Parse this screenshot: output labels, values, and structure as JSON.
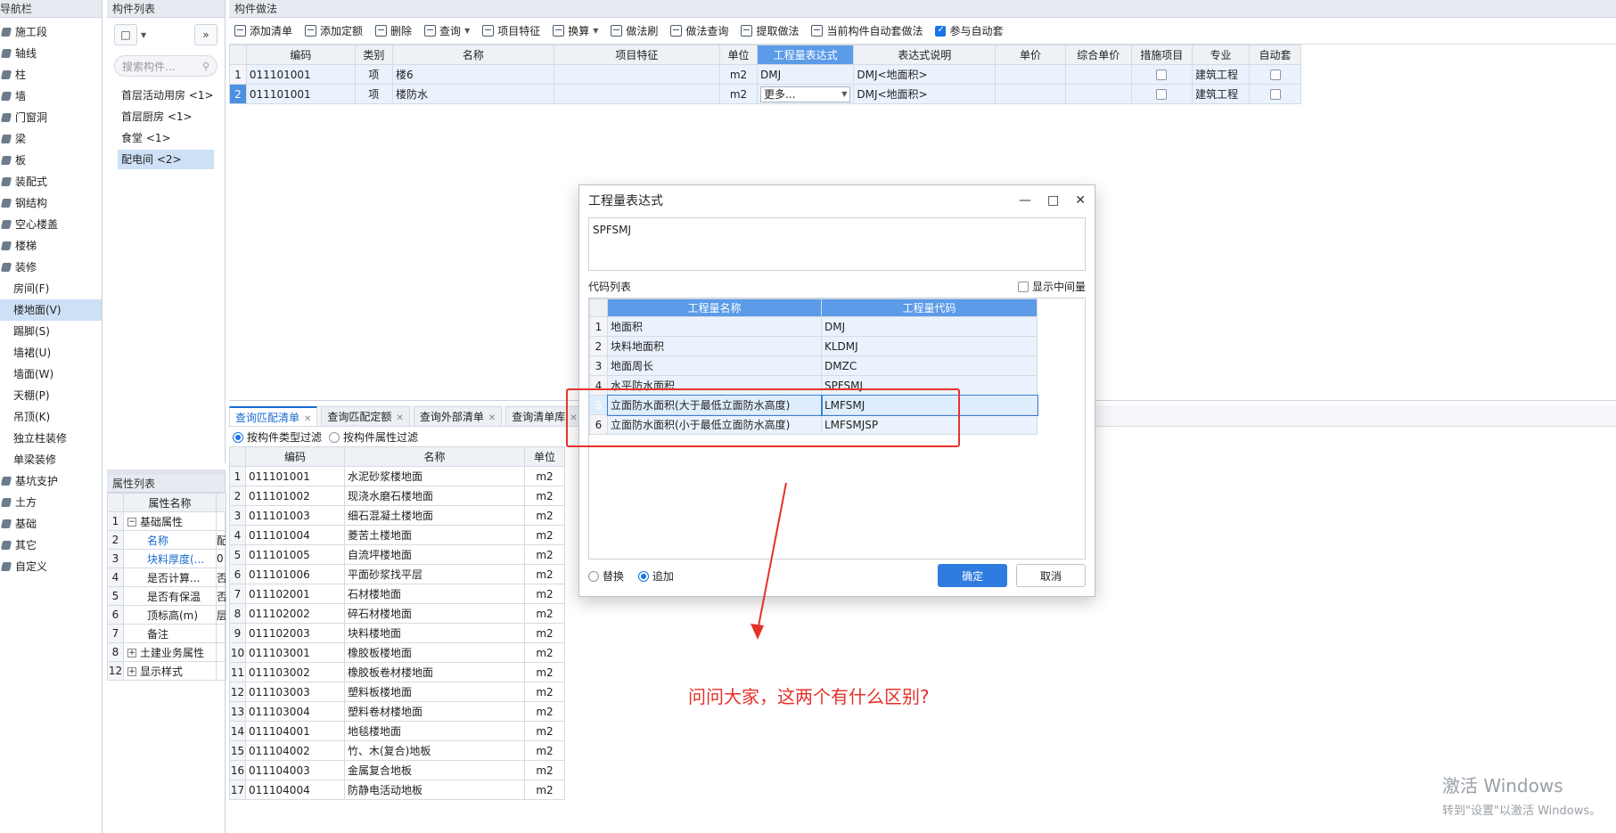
{
  "nav": {
    "title": "导航栏",
    "items": [
      {
        "label": "施工段",
        "sub": false,
        "active": false
      },
      {
        "label": "轴线",
        "sub": false,
        "active": false
      },
      {
        "label": "柱",
        "sub": false,
        "active": false
      },
      {
        "label": "墙",
        "sub": false,
        "active": false
      },
      {
        "label": "门窗洞",
        "sub": false,
        "active": false
      },
      {
        "label": "梁",
        "sub": false,
        "active": false
      },
      {
        "label": "板",
        "sub": false,
        "active": false
      },
      {
        "label": "装配式",
        "sub": false,
        "active": false
      },
      {
        "label": "钢结构",
        "sub": false,
        "active": false
      },
      {
        "label": "空心楼盖",
        "sub": false,
        "active": false
      },
      {
        "label": "楼梯",
        "sub": false,
        "active": false
      },
      {
        "label": "装修",
        "sub": false,
        "active": false
      },
      {
        "label": "房间(F)",
        "sub": true,
        "active": false
      },
      {
        "label": "楼地面(V)",
        "sub": true,
        "active": true
      },
      {
        "label": "踢脚(S)",
        "sub": true,
        "active": false
      },
      {
        "label": "墙裙(U)",
        "sub": true,
        "active": false
      },
      {
        "label": "墙面(W)",
        "sub": true,
        "active": false
      },
      {
        "label": "天棚(P)",
        "sub": true,
        "active": false
      },
      {
        "label": "吊顶(K)",
        "sub": true,
        "active": false
      },
      {
        "label": "独立柱装修",
        "sub": true,
        "active": false
      },
      {
        "label": "单梁装修",
        "sub": true,
        "active": false
      },
      {
        "label": "基坑支护",
        "sub": false,
        "active": false
      },
      {
        "label": "土方",
        "sub": false,
        "active": false
      },
      {
        "label": "基础",
        "sub": false,
        "active": false
      },
      {
        "label": "其它",
        "sub": false,
        "active": false
      },
      {
        "label": "自定义",
        "sub": false,
        "active": false
      }
    ]
  },
  "components": {
    "title": "构件列表",
    "search_placeholder": "搜索构件...",
    "items": [
      {
        "label": "首层活动用房 <1>",
        "active": false
      },
      {
        "label": "首层厨房 <1>",
        "active": false
      },
      {
        "label": "食堂 <1>",
        "active": false
      },
      {
        "label": "配电间 <2>",
        "active": true
      }
    ]
  },
  "properties": {
    "title": "属性列表",
    "header": "属性名称",
    "rows": [
      {
        "num": "1",
        "label": "基础属性",
        "group": "minus",
        "indent": false,
        "link": false,
        "value": ""
      },
      {
        "num": "2",
        "label": "名称",
        "group": "",
        "indent": true,
        "link": true,
        "value": "配"
      },
      {
        "num": "3",
        "label": "块料厚度(...",
        "group": "",
        "indent": true,
        "link": true,
        "value": "0"
      },
      {
        "num": "4",
        "label": "是否计算...",
        "group": "",
        "indent": true,
        "link": false,
        "value": "否"
      },
      {
        "num": "5",
        "label": "是否有保温",
        "group": "",
        "indent": true,
        "link": false,
        "value": "否"
      },
      {
        "num": "6",
        "label": "顶标高(m)",
        "group": "",
        "indent": true,
        "link": false,
        "value": "层"
      },
      {
        "num": "7",
        "label": "备注",
        "group": "",
        "indent": true,
        "link": false,
        "value": ""
      },
      {
        "num": "8",
        "label": "土建业务属性",
        "group": "plus",
        "indent": false,
        "link": false,
        "value": ""
      },
      {
        "num": "12",
        "label": "显示样式",
        "group": "plus",
        "indent": false,
        "link": false,
        "value": ""
      }
    ]
  },
  "methods": {
    "title": "构件做法",
    "toolbar": [
      {
        "label": "添加清单",
        "caret": false
      },
      {
        "label": "添加定额",
        "caret": false
      },
      {
        "label": "删除",
        "caret": false
      },
      {
        "label": "查询",
        "caret": true
      },
      {
        "label": "项目特征",
        "caret": false
      },
      {
        "label": "换算",
        "caret": true
      },
      {
        "label": "做法刷",
        "caret": false
      },
      {
        "label": "做法查询",
        "caret": false
      },
      {
        "label": "提取做法",
        "caret": false
      },
      {
        "label": "当前构件自动套做法",
        "caret": false
      }
    ],
    "auto_checkbox_label": "参与自动套",
    "columns": [
      "编码",
      "类别",
      "名称",
      "项目特征",
      "单位",
      "工程量表达式",
      "表达式说明",
      "单价",
      "综合单价",
      "措施项目",
      "专业",
      "自动套"
    ],
    "rows": [
      {
        "num": "1",
        "code": "011101001",
        "type": "项",
        "name": "楼6",
        "feature": "",
        "unit": "m2",
        "expr": "DMJ",
        "desc": "DMJ<地面积>",
        "price": "",
        "total": "",
        "major": "建筑工程"
      },
      {
        "num": "2",
        "code": "011101001",
        "type": "项",
        "name": "楼防水",
        "feature": "",
        "unit": "m2",
        "expr": "更多...",
        "desc": "DMJ<地面积>",
        "price": "",
        "total": "",
        "major": "建筑工程"
      }
    ]
  },
  "query": {
    "tabs": [
      "查询匹配清单",
      "查询匹配定额",
      "查询外部清单",
      "查询清单库"
    ],
    "filter_type": "按构件类型过滤",
    "filter_attr": "按构件属性过滤",
    "columns": [
      "编码",
      "名称",
      "单位"
    ],
    "rows": [
      {
        "num": "1",
        "code": "011101001",
        "name": "水泥砂浆楼地面",
        "unit": "m2"
      },
      {
        "num": "2",
        "code": "011101002",
        "name": "现浇水磨石楼地面",
        "unit": "m2"
      },
      {
        "num": "3",
        "code": "011101003",
        "name": "细石混凝土楼地面",
        "unit": "m2"
      },
      {
        "num": "4",
        "code": "011101004",
        "name": "菱苦土楼地面",
        "unit": "m2"
      },
      {
        "num": "5",
        "code": "011101005",
        "name": "自流坪楼地面",
        "unit": "m2"
      },
      {
        "num": "6",
        "code": "011101006",
        "name": "平面砂浆找平层",
        "unit": "m2"
      },
      {
        "num": "7",
        "code": "011102001",
        "name": "石材楼地面",
        "unit": "m2"
      },
      {
        "num": "8",
        "code": "011102002",
        "name": "碎石材楼地面",
        "unit": "m2"
      },
      {
        "num": "9",
        "code": "011102003",
        "name": "块料楼地面",
        "unit": "m2"
      },
      {
        "num": "10",
        "code": "011103001",
        "name": "橡胶板楼地面",
        "unit": "m2"
      },
      {
        "num": "11",
        "code": "011103002",
        "name": "橡胶板卷材楼地面",
        "unit": "m2"
      },
      {
        "num": "12",
        "code": "011103003",
        "name": "塑料板楼地面",
        "unit": "m2"
      },
      {
        "num": "13",
        "code": "011103004",
        "name": "塑料卷材楼地面",
        "unit": "m2"
      },
      {
        "num": "14",
        "code": "011104001",
        "name": "地毯楼地面",
        "unit": "m2"
      },
      {
        "num": "15",
        "code": "011104002",
        "name": "竹、木(复合)地板",
        "unit": "m2"
      },
      {
        "num": "16",
        "code": "011104003",
        "name": "金属复合地板",
        "unit": "m2"
      },
      {
        "num": "17",
        "code": "011104004",
        "name": "防静电活动地板",
        "unit": "m2"
      }
    ]
  },
  "dialog": {
    "title": "工程量表达式",
    "expression": "SPFSMJ",
    "code_list_label": "代码列表",
    "show_intermediate_label": "显示中间量",
    "columns": [
      "工程量名称",
      "工程量代码"
    ],
    "rows": [
      {
        "num": "1",
        "name": "地面积",
        "code": "DMJ"
      },
      {
        "num": "2",
        "name": "块料地面积",
        "code": "KLDMJ"
      },
      {
        "num": "3",
        "name": "地面周长",
        "code": "DMZC"
      },
      {
        "num": "4",
        "name": "水平防水面积",
        "code": "SPFSMJ"
      },
      {
        "num": "5",
        "name": "立面防水面积(大于最低立面防水高度)",
        "code": "LMFSMJ"
      },
      {
        "num": "6",
        "name": "立面防水面积(小于最低立面防水高度)",
        "code": "LMFSMJSP"
      }
    ],
    "selected_row": 5,
    "replace_label": "替换",
    "append_label": "追加",
    "ok_label": "确定",
    "cancel_label": "取消"
  },
  "annotation": {
    "question": "问问大家，这两个有什么区别?",
    "color": "#e5312a"
  },
  "watermark": {
    "line1": "激活 Windows",
    "line2": "转到\"设置\"以激活 Windows。"
  }
}
